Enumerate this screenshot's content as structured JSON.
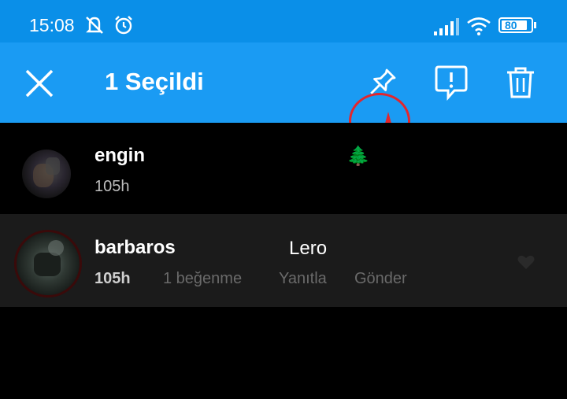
{
  "status_bar": {
    "time": "15:08",
    "battery": "80",
    "icons": [
      "mute-notification-icon",
      "alarm-icon",
      "signal-icon",
      "wifi-icon",
      "battery-icon"
    ]
  },
  "app_bar": {
    "title": "1 Seçildi",
    "actions": [
      "close-icon",
      "pin-icon",
      "report-icon",
      "trash-icon"
    ],
    "accent": "#1a9bf3"
  },
  "comments": [
    {
      "user": "engin",
      "time": "105h",
      "text": "🌲"
    },
    {
      "user": "barbaros",
      "time": "105h",
      "text": "Lero",
      "likes": "1 beğenme",
      "reply": "Yanıtla",
      "send": "Gönder"
    }
  ],
  "annotation": {
    "color": "#e3262d"
  }
}
